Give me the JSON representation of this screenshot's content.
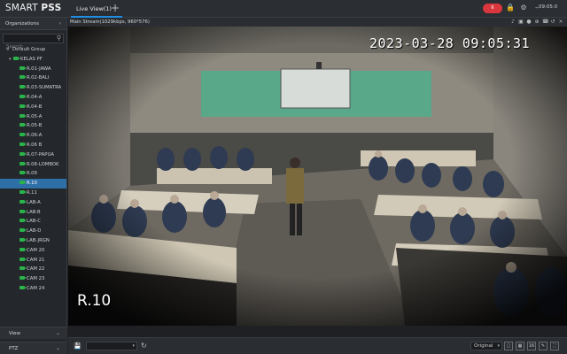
{
  "app": {
    "title_light": "SMART ",
    "title_bold": "PSS",
    "live_tab": "Live View(1)",
    "add_tab_symbol": "+",
    "rec_badge": "6",
    "clock": "09:05:0"
  },
  "sidebar": {
    "organizations_label": "Organizations",
    "search_placeholder": "Search",
    "default_group": "Default Group",
    "group_name": "KELAS PF",
    "selected_item": "R.10",
    "items": [
      "R.01-JAWA",
      "R.02-BALI",
      "R.03-SUMATRA",
      "R.04-A",
      "R.04-B",
      "R.05-A",
      "R.05-B",
      "R.06-A",
      "R.06 B",
      "R.07-PAPUA",
      "R.08-LOMBOK",
      "R.09",
      "R.10",
      "R.11",
      "LAB-A",
      "LAB-B",
      "LAB-C",
      "LAB-D",
      "LAB-JRGN",
      "CAM 20",
      "CAM 21",
      "CAM 22",
      "CAM 23",
      "CAM 24"
    ],
    "view_label": "View",
    "ptz_label": "PTZ"
  },
  "video": {
    "stream_info": "Main Stream(1029kbps, 960*576)",
    "osd_timestamp": "2023-03-28  09:05:31",
    "osd_channel": "R.10"
  },
  "toolbar": {
    "select_value": "",
    "scale_value": "Original",
    "layout_16_label": "16"
  },
  "colors": {
    "accent": "#1f8ce6",
    "selected_row": "#2f6fa8",
    "camera_online": "#29b349",
    "recording_badge": "#d9363e"
  }
}
